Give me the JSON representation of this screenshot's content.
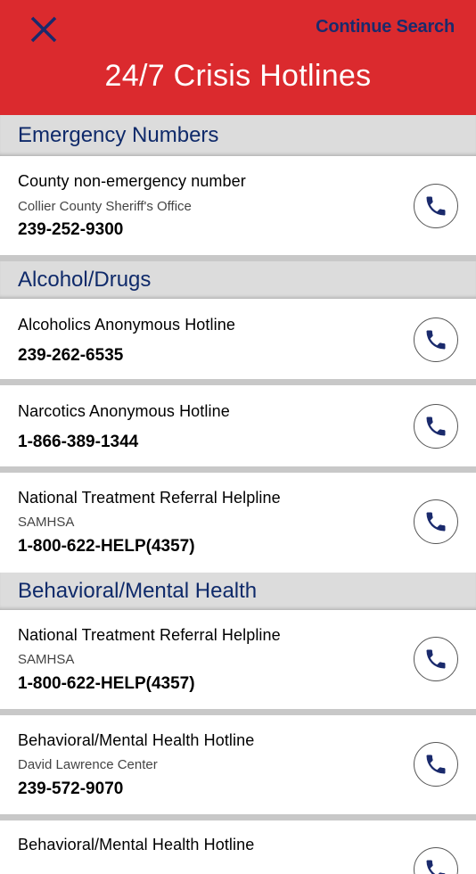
{
  "header": {
    "continue_label": "Continue Search",
    "title": "24/7 Crisis Hotlines",
    "bg_color": "#db2a2e"
  },
  "sections": [
    {
      "title": "Emergency Numbers",
      "items": [
        {
          "title": "County non-emergency number",
          "org": "Collier County Sheriff's Office",
          "phone": "239-252-9300"
        }
      ]
    },
    {
      "title": "Alcohol/Drugs",
      "items": [
        {
          "title": "Alcoholics Anonymous Hotline",
          "org": "",
          "phone": "239-262-6535"
        },
        {
          "title": "Narcotics Anonymous Hotline",
          "org": "",
          "phone": "1-866-389-1344"
        },
        {
          "title": "National Treatment Referral Helpline",
          "org": "SAMHSA",
          "phone": "1-800-622-HELP(4357)"
        }
      ]
    },
    {
      "title": "Behavioral/Mental Health",
      "items": [
        {
          "title": "National Treatment Referral Helpline",
          "org": "SAMHSA",
          "phone": "1-800-622-HELP(4357)"
        },
        {
          "title": "Behavioral/Mental Health Hotline",
          "org": "David Lawrence Center",
          "phone": "239-572-9070"
        },
        {
          "title": "Behavioral/Mental Health Hotline",
          "org": "",
          "phone": ""
        }
      ]
    }
  ]
}
